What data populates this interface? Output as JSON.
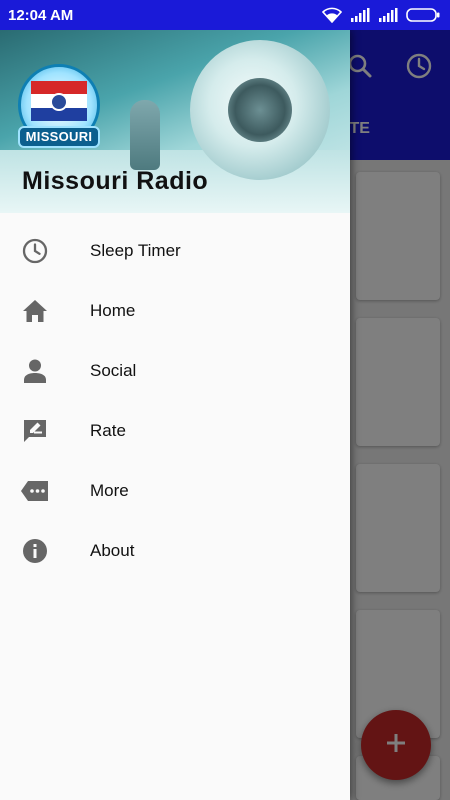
{
  "status_bar": {
    "time": "12:04 AM",
    "icons": [
      "wifi-icon",
      "signal-icon",
      "signal-icon",
      "battery-icon"
    ]
  },
  "app_bar": {
    "actions": [
      "search-icon",
      "clock-icon"
    ],
    "tab_label": "AVORITE"
  },
  "drawer": {
    "logo_text": "MISSOURI",
    "title": "Missouri Radio",
    "items": [
      {
        "label": "Sleep Timer",
        "icon": "clock-icon"
      },
      {
        "label": "Home",
        "icon": "home-icon"
      },
      {
        "label": "Social",
        "icon": "person-icon"
      },
      {
        "label": "Rate",
        "icon": "rate-icon"
      },
      {
        "label": "More",
        "icon": "more-icon"
      },
      {
        "label": "About",
        "icon": "info-icon"
      }
    ]
  },
  "fab": {
    "icon": "plus-icon"
  },
  "colors": {
    "primary": "#1a1ad8",
    "accent": "#c62828",
    "drawer_bg": "#fafafa",
    "icon_gray": "#666666"
  }
}
